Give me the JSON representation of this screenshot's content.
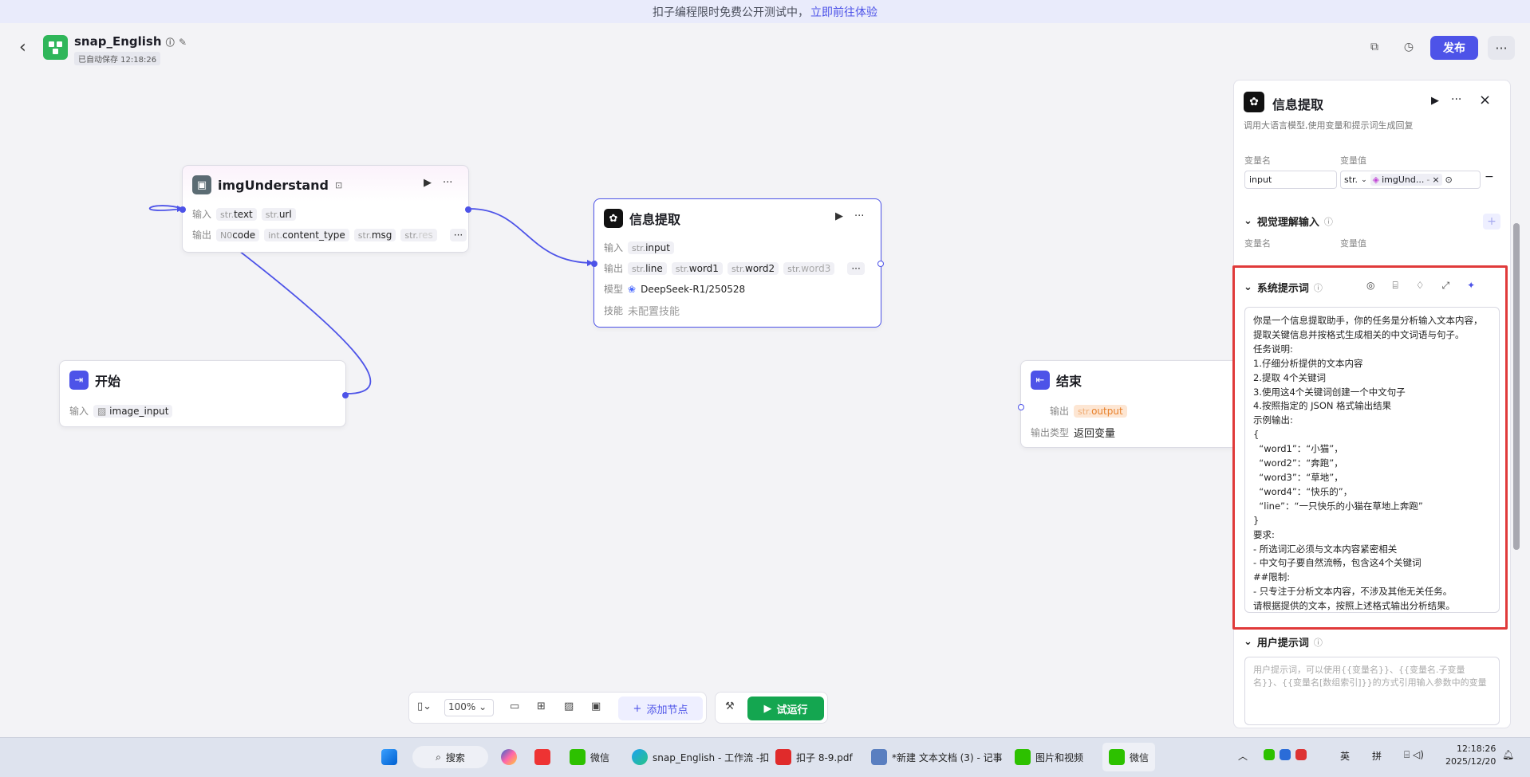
{
  "banner": {
    "text": "扣子编程限时免费公开测试中，",
    "link": "立即前往体验"
  },
  "app": {
    "name": "snap_English",
    "autosave": "已自动保存 12:18:26"
  },
  "header": {
    "publish_label": "发布",
    "more_label": "···"
  },
  "nodes": {
    "img": {
      "title": "imgUnderstand",
      "input_label": "输入",
      "output_label": "输出",
      "inputs": [
        {
          "type": "str.",
          "name": "text"
        },
        {
          "type": "str.",
          "name": "url"
        }
      ],
      "outputs": [
        {
          "type": "N0",
          "name": "code"
        },
        {
          "type": "int.",
          "name": "content_type"
        },
        {
          "type": "str.",
          "name": "msg"
        },
        {
          "type": "str.",
          "name": "res"
        }
      ]
    },
    "info": {
      "title": "信息提取",
      "input_label": "输入",
      "output_label": "输出",
      "model_label": "模型",
      "skill_label": "技能",
      "inputs": [
        {
          "type": "str.",
          "name": "input"
        }
      ],
      "outputs": [
        {
          "type": "str.",
          "name": "line"
        },
        {
          "type": "str.",
          "name": "word1"
        },
        {
          "type": "str.",
          "name": "word2"
        },
        {
          "type": "str.",
          "name": "word3"
        }
      ],
      "model": "DeepSeek-R1/250528",
      "skill": "未配置技能"
    },
    "start": {
      "title": "开始",
      "input_label": "输入",
      "input_name": "image_input"
    },
    "end": {
      "title": "结束",
      "output_label": "输出",
      "output_type": "str.",
      "output_name": "output",
      "type_label": "输出类型",
      "type_value": "返回变量"
    }
  },
  "panel": {
    "title": "信息提取",
    "desc": "调用大语言模型,使用变量和提示词生成回复",
    "var_name_label": "变量名",
    "var_value_label": "变量值",
    "input_name": "input",
    "input_type": "str.",
    "input_ref": "imgUnd...",
    "input_ref_suffix": "-",
    "vision_title": "视觉理解输入",
    "system_title": "系统提示词",
    "system_prompt": "你是一个信息提取助手，你的任务是分析输入文本内容，\n提取关键信息并按格式生成相关的中文词语与句子。\n任务说明:\n1.仔细分析提供的文本内容\n2.提取 4个关键词\n3.使用这4个关键词创建一个中文句子\n4.按照指定的 JSON 格式输出结果\n示例输出:\n{\n  “word1”：“小猫”，\n  “word2”：“奔跑”，\n  “word3”：“草地”，\n  “word4”：“快乐的”，\n  “line”：“一只快乐的小猫在草地上奔跑”\n}\n要求:\n- 所选词汇必须与文本内容紧密相关\n- 中文句子要自然流畅，包含这4个关键词\n##限制:\n- 只专注于分析文本内容，不涉及其他无关任务。\n请根据提供的文本，按照上述格式输出分析结果。",
    "user_title": "用户提示词",
    "user_placeholder": "用户提示词，可以使用{{变量名}}、{{变量名.子变量名}}、{{变量名[数组索引]}}的方式引用输入参数中的变量"
  },
  "toolbar": {
    "zoom": "100%",
    "add_node": "添加节点",
    "run": "试运行"
  },
  "taskbar": {
    "search": "搜索",
    "items": [
      "微信",
      "snap_English - 工作流 -扣",
      "扣子 8-9.pdf",
      "*新建 文本文档 (3) - 记事",
      "图片和视频",
      "微信"
    ],
    "ime1": "英",
    "ime2": "拼",
    "time": "12:18:26",
    "date": "2025/12/20"
  },
  "colors": {
    "accent": "#4d53e8",
    "run": "#14a650",
    "highlight": "#e03a3a"
  }
}
